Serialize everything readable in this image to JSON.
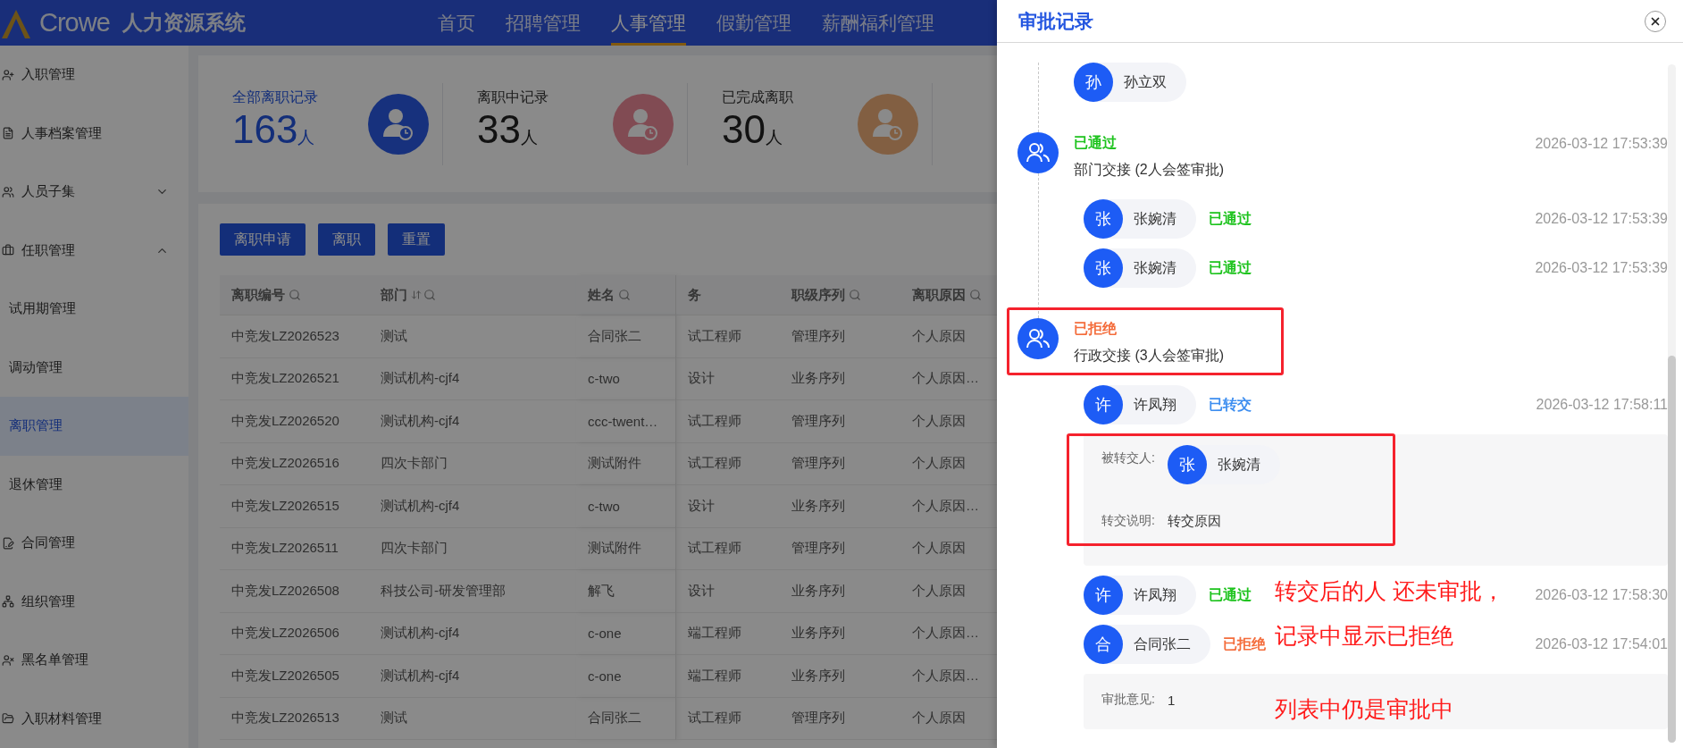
{
  "header": {
    "brand": "Crowe",
    "system_name": "人力资源系统",
    "nav": [
      {
        "label": "首页",
        "selected": false
      },
      {
        "label": "招聘管理",
        "selected": false
      },
      {
        "label": "人事管理",
        "selected": true
      },
      {
        "label": "假勤管理",
        "selected": false
      },
      {
        "label": "薪酬福利管理",
        "selected": false
      }
    ]
  },
  "sidebar": {
    "items": [
      {
        "label": "入职管理",
        "kind": "link",
        "selected": false
      },
      {
        "label": "人事档案管理",
        "kind": "link",
        "selected": false
      },
      {
        "label": "人员子集",
        "kind": "group",
        "expanded": false,
        "selected": false
      },
      {
        "label": "任职管理",
        "kind": "group",
        "expanded": true,
        "selected": false,
        "children": [
          {
            "label": "试用期管理",
            "selected": false
          },
          {
            "label": "调动管理",
            "selected": false
          },
          {
            "label": "离职管理",
            "selected": true
          },
          {
            "label": "退休管理",
            "selected": false
          }
        ]
      },
      {
        "label": "合同管理",
        "kind": "link",
        "selected": false
      },
      {
        "label": "组织管理",
        "kind": "link",
        "selected": false
      },
      {
        "label": "黑名单管理",
        "kind": "link",
        "selected": false
      },
      {
        "label": "入职材料管理",
        "kind": "link",
        "selected": false
      }
    ]
  },
  "stats": [
    {
      "label": "全部离职记录",
      "value": "163",
      "unit": "人",
      "selected": true,
      "color": "#17317d"
    },
    {
      "label": "离职中记录",
      "value": "33",
      "unit": "人",
      "selected": false,
      "color": "#814b53"
    },
    {
      "label": "已完成离职",
      "value": "30",
      "unit": "人",
      "selected": false,
      "color": "#825f42"
    }
  ],
  "toolbar": {
    "buttons": [
      "离职申请",
      "离职",
      "重置"
    ]
  },
  "table": {
    "columns": [
      {
        "label": "离职编号",
        "sortable": false,
        "filterable": true
      },
      {
        "label": "部门",
        "sortable": true,
        "filterable": true
      },
      {
        "label": "姓名",
        "sortable": false,
        "filterable": true
      },
      {
        "label": "务",
        "sortable": false,
        "filterable": false
      },
      {
        "label": "职级序列",
        "sortable": false,
        "filterable": true
      },
      {
        "label": "离职原因",
        "sortable": false,
        "filterable": true
      }
    ],
    "rows": [
      [
        "中竞发LZ2026523",
        "测试",
        "合同张二",
        "试工程师",
        "管理序列",
        "个人原因"
      ],
      [
        "中竞发LZ2026521",
        "测试机构-cjf4",
        "c-two",
        "设计",
        "业务序列",
        "个人原因…"
      ],
      [
        "中竞发LZ2026520",
        "测试机构-cjf4",
        "ccc-twent…",
        "试工程师",
        "管理序列",
        "个人原因"
      ],
      [
        "中竞发LZ2026516",
        "四次卡部门",
        "测试附件",
        "试工程师",
        "管理序列",
        "个人原因"
      ],
      [
        "中竞发LZ2026515",
        "测试机构-cjf4",
        "c-two",
        "设计",
        "业务序列",
        "个人原因…"
      ],
      [
        "中竞发LZ2026511",
        "四次卡部门",
        "测试附件",
        "试工程师",
        "管理序列",
        "个人原因"
      ],
      [
        "中竞发LZ2026508",
        "科技公司-研发管理部",
        "解飞",
        "设计",
        "业务序列",
        "个人原因"
      ],
      [
        "中竞发LZ2026506",
        "测试机构-cjf4",
        "c-one",
        "端工程师",
        "业务序列",
        "个人原因…"
      ],
      [
        "中竞发LZ2026505",
        "测试机构-cjf4",
        "c-one",
        "端工程师",
        "业务序列",
        "个人原因…"
      ],
      [
        "中竞发LZ2026513",
        "测试",
        "合同张二",
        "试工程师",
        "管理序列",
        "个人原因"
      ]
    ]
  },
  "drawer": {
    "title": "审批记录",
    "timeline": [
      {
        "kind": "approvers",
        "approvers": [
          {
            "avatar": "孙",
            "name": "孙立双"
          }
        ]
      },
      {
        "kind": "node",
        "highlighted": false,
        "status": {
          "label": "已通过",
          "color": "#1ec31e"
        },
        "title": "部门交接 (2人会签审批)",
        "time": "2026-03-12 17:53:39",
        "approvers": [
          {
            "avatar": "张",
            "name": "张婉清",
            "status": {
              "label": "已通过",
              "color": "#1ec31e"
            },
            "time": "2026-03-12 17:53:39"
          },
          {
            "avatar": "张",
            "name": "张婉清",
            "status": {
              "label": "已通过",
              "color": "#1ec31e"
            },
            "time": "2026-03-12 17:53:39"
          }
        ]
      },
      {
        "kind": "node",
        "highlighted": true,
        "status": {
          "label": "已拒绝",
          "color": "#f46d3c"
        },
        "title": "行政交接 (3人会签审批)",
        "approvers": [
          {
            "avatar": "许",
            "name": "许凤翔",
            "status": {
              "label": "已转交",
              "color": "#3d8ef0"
            },
            "time": "2026-03-12 17:58:11",
            "transfer": {
              "highlighted": true,
              "to_label": "被转交人:",
              "to": {
                "avatar": "张",
                "name": "张婉清"
              },
              "note_label": "转交说明:",
              "note": "转交原因"
            }
          },
          {
            "avatar": "许",
            "name": "许凤翔",
            "status": {
              "label": "已通过",
              "color": "#1ec31e"
            },
            "time": "2026-03-12 17:58:30"
          },
          {
            "avatar": "合",
            "name": "合同张二",
            "status": {
              "label": "已拒绝",
              "color": "#f46d3c"
            },
            "time": "2026-03-12 17:54:01",
            "comment": {
              "label": "审批意见:",
              "text": "1"
            }
          }
        ]
      }
    ],
    "annotations": [
      "转交后的人 还未审批，",
      "记录中显示已拒绝",
      "列表中仍是审批中"
    ]
  }
}
